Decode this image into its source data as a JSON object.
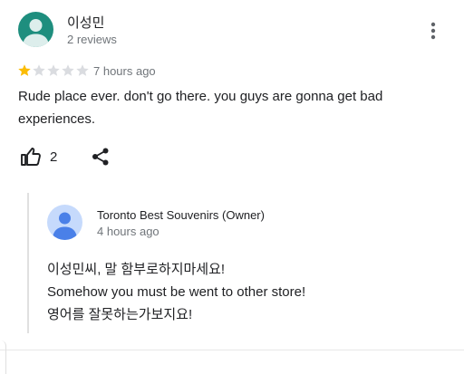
{
  "review": {
    "reviewer_name": "이성민",
    "reviewer_meta": "2 reviews",
    "avatar_color": "#1e8e7e",
    "rating": 1,
    "rating_max": 5,
    "star_filled_color": "#fbbc04",
    "star_empty_color": "#dadce0",
    "time": "7 hours ago",
    "text": "Rude place ever. don't go there. you guys are gonna get bad experiences.",
    "like_count": "2",
    "icons": {
      "more": "more-vert-icon",
      "like": "thumbs-up-icon",
      "share": "share-icon"
    }
  },
  "owner_reply": {
    "name": "Toronto Best Souvenirs (Owner)",
    "time": "4 hours ago",
    "avatar_color": "#c6dafc",
    "lines": [
      "이성민씨, 말 함부로하지마세요!",
      "Somehow you must be went to other store!",
      "영어를 잘못하는가보지요!"
    ]
  }
}
